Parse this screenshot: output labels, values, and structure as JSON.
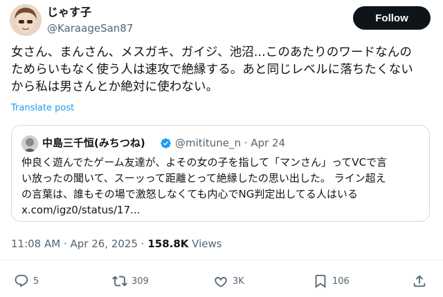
{
  "author": {
    "name": "じゃす子",
    "handle": "@KaraageSan87"
  },
  "follow_label": "Follow",
  "post": {
    "lines": [
      "女さん、まんさん、メスガキ、ガイジ、池沼...このあたりのワードなんの",
      "ためらいもなく使う人は速攻で絶縁する。あと同じレベルに落ちたくない",
      "から私は男さんとか絶対に使わない。"
    ],
    "translate_label": "Translate post"
  },
  "quoted": {
    "name": "中島三千恒(みちつね)",
    "handle_date": "@mititune_n · Apr 24",
    "verified_icon": "verified-badge-icon",
    "lines": [
      "仲良く遊んでたゲーム友達が、よその女の子を指して「マンさん」ってVCで言",
      "い放ったの聞いて、スーッって距離とって絶縁したの思い出した。 ライン超え",
      "の言葉は、誰もその場で激怒しなくても内心でNG判定出してる人はいる",
      "x.com/igz0/status/17..."
    ]
  },
  "meta": {
    "timestamp": "11:08 AM · Apr 26, 2025 · ",
    "views_count": "158.8K",
    "views_label": " Views"
  },
  "actions": {
    "replies": "5",
    "reposts": "309",
    "likes": "3K",
    "bookmarks": "106"
  },
  "colors": {
    "accent": "#1d9bf0",
    "text": "#0f1419",
    "secondary": "#536471",
    "border": "#cfd9de"
  }
}
